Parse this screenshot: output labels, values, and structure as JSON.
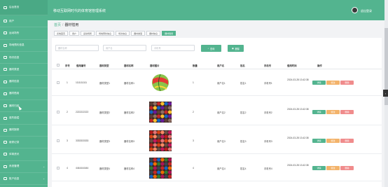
{
  "header": {
    "title": "移动互联网时代的体育馆管理系统",
    "user": "退出登录"
  },
  "sidebar": {
    "items": [
      {
        "label": "后台首页"
      },
      {
        "label": "用户"
      },
      {
        "label": "运动场所"
      },
      {
        "label": "场地预约信息"
      },
      {
        "label": "场次信息"
      },
      {
        "label": "器材类型"
      },
      {
        "label": "器材信息"
      },
      {
        "label": "器材借用"
      },
      {
        "label": "器材归还"
      },
      {
        "label": "遗失赔偿"
      },
      {
        "label": "器材报修"
      },
      {
        "label": "维修记录"
      },
      {
        "label": "体育资讯"
      },
      {
        "label": "系统管理"
      },
      {
        "label": "账户信息"
      }
    ]
  },
  "breadcrumb": {
    "home": "首页",
    "current": "器材借用"
  },
  "tags": [
    "系统首页",
    "用户",
    "运动场所",
    "场地预约信息",
    "场次信息",
    "器材类型",
    "器材信息",
    "器材借用"
  ],
  "filters": {
    "equip_name_placeholder": "器材名称",
    "username_placeholder": "用户名",
    "phone_placeholder": "手机号",
    "search_label": "查询",
    "delete_label": "删除"
  },
  "table": {
    "headers": [
      "序号",
      "借用编号",
      "器材类型",
      "器材名称",
      "器材图片",
      "数量",
      "用户名",
      "姓名",
      "手机号",
      "借用时间",
      "操作"
    ],
    "rows": [
      {
        "index": "1",
        "code": "1111111111",
        "type": "器材类型1",
        "name": "器材名称1",
        "qty": "1",
        "username": "用户名1",
        "realname": "姓名1",
        "phone": "手机号1",
        "time": "2024-03-28 13:42:38"
      },
      {
        "index": "2",
        "code": "2222222222",
        "type": "器材类型2",
        "name": "器材名称2",
        "qty": "2",
        "username": "用户名2",
        "realname": "姓名2",
        "phone": "手机号2",
        "time": "2024-03-28 13:42:38"
      },
      {
        "index": "3",
        "code": "3333333333",
        "type": "器材类型3",
        "name": "器材名称3",
        "qty": "3",
        "username": "用户名3",
        "realname": "姓名3",
        "phone": "手机号3",
        "time": "2024-03-28 13:42:38"
      },
      {
        "index": "4",
        "code": "4444444444",
        "type": "器材类型4",
        "name": "器材名称4",
        "qty": "4",
        "username": "用户名4",
        "realname": "姓名4",
        "phone": "手机号4",
        "time": "2024-03-28 13:42:38"
      }
    ],
    "actions": {
      "detail": "详情",
      "edit": "修改",
      "delete": "删除"
    }
  },
  "colors": {
    "accent": "#53b48f",
    "edit": "#f3b36b",
    "delete": "#f08c8c"
  }
}
